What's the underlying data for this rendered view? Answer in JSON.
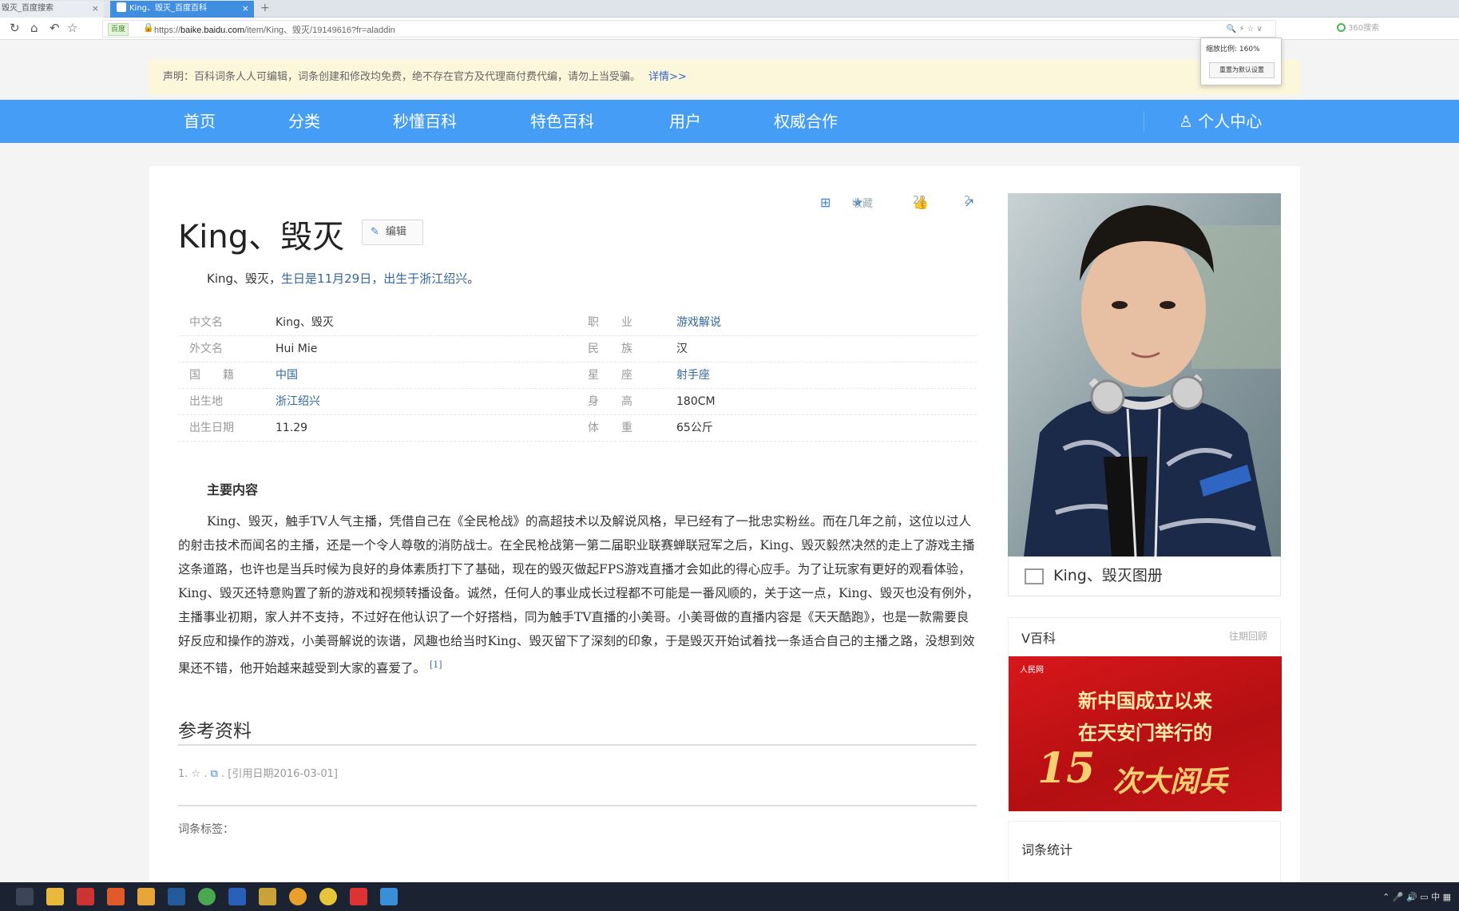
{
  "browser": {
    "tabs": [
      {
        "label": "毁灭_百度搜索",
        "active": false
      },
      {
        "label": "King、毁灭_百度百科",
        "active": true
      }
    ],
    "new_tab": "+",
    "secure_badge": "百度",
    "url_prefix": "https://",
    "url_host": "baike.baidu.com",
    "url_path": "/item/King、毁灭/19149616?fr=aladdin",
    "search_engine": "360搜索",
    "zoom_label": "缩放比例:  160%",
    "zoom_reset": "重置为默认设置"
  },
  "notice": {
    "text": "声明：百科词条人人可编辑，词条创建和修改均免费，绝不存在官方及代理商付费代编，请勿上当受骗。",
    "link": "详情>>"
  },
  "nav": {
    "items": [
      "首页",
      "分类",
      "秒懂百科",
      "特色百科",
      "用户",
      "权威合作"
    ],
    "personal": "个人中心"
  },
  "article": {
    "title": "King、毁灭",
    "edit_label": "编辑",
    "collect_label": "收藏",
    "like_count": "22",
    "share_count": "2",
    "summary_pre": "King、毁灭，",
    "summary_birth": "生日是11月29日，",
    "summary_link": "出生于浙江绍兴",
    "summary_end": "。",
    "infobox": [
      {
        "k1": "中文名",
        "v1": "King、毁灭",
        "k2": "职　　业",
        "v2": "游戏解说"
      },
      {
        "k1": "外文名",
        "v1": "Hui Mie",
        "k2": "民　　族",
        "v2": "汉"
      },
      {
        "k1": "国　　籍",
        "v1": "中国",
        "k2": "星　　座",
        "v2": "射手座"
      },
      {
        "k1": "出生地",
        "v1": "浙江绍兴",
        "k2": "身　　高",
        "v2": "180CM"
      },
      {
        "k1": "出生日期",
        "v1": "11.29",
        "k2": "体　　重",
        "v2": "65公斤"
      }
    ],
    "section_title": "主要内容",
    "paragraph": "King、毁灭，触手TV人气主播，凭借自己在《全民枪战》的高超技术以及解说风格，早已经有了一批忠实粉丝。而在几年之前，这位以过人的射击技术而闻名的主播，还是一个令人尊敬的消防战士。在全民枪战第一第二届职业联赛蝉联冠军之后，King、毁灭毅然决然的走上了游戏主播这条道路，也许也是当兵时候为良好的身体素质打下了基础，现在的毁灭做起FPS游戏直播才会如此的得心应手。为了让玩家有更好的观看体验，King、毁灭还特意购置了新的游戏和视频转播设备。诚然，任何人的事业成长过程都不可能是一番风顺的，关于这一点，King、毁灭也没有例外，主播事业初期，家人并不支持，不过好在他认识了一个好搭档，同为触手TV直播的小美哥。小美哥做的直播内容是《天天酷跑》，也是一款需要良好反应和操作的游戏，小美哥解说的诙谐，风趣也给当时King、毁灭留下了深刻的印象，于是毁灭开始试着找一条适合自己的主播之路，没想到效果还不错，他开始越来越受到大家的喜爱了。",
    "cite": "[1]",
    "ref_title": "参考资料",
    "ref_item": "1. ☆ . ",
    "ref_date": " . [引用日期2016-03-01]",
    "tags_title": "词条标签："
  },
  "side": {
    "album_caption": "King、毁灭图册",
    "vbaike_title": "V百科",
    "vbaike_more": "往期回顾",
    "banner_logo": "人民网",
    "banner_line1": "新中国成立以来",
    "banner_line2": "在天安门举行的",
    "banner_num": "15",
    "banner_line3": "次大阅兵",
    "stats_title": "词条统计"
  },
  "colors": {
    "nav_blue": "#459df5",
    "tab_active": "#3f8ee0",
    "notice_bg": "#fcf6da",
    "link": "#336699",
    "banner_red": "#d8171b"
  }
}
